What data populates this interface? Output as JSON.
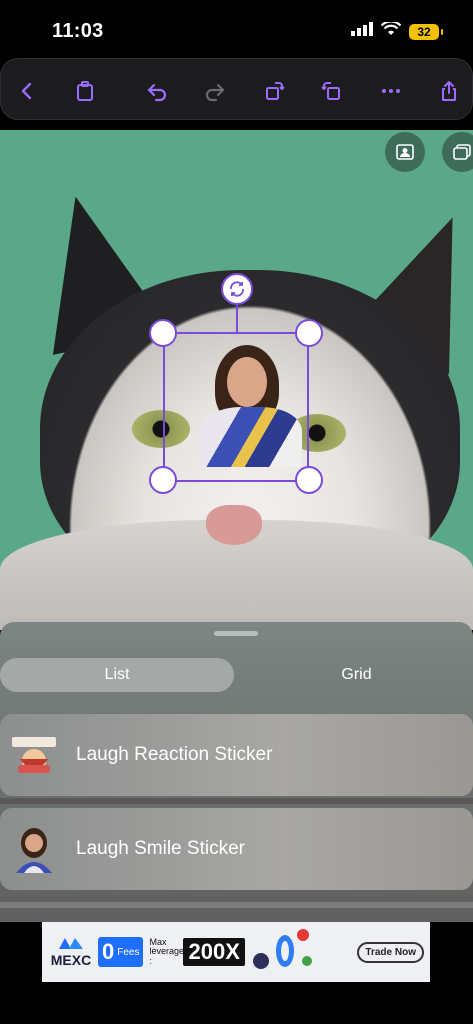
{
  "status_bar": {
    "time": "11:03",
    "battery": "32"
  },
  "toolbar": {
    "buttons": [
      {
        "icon": "chevron-left-icon"
      },
      {
        "icon": "clipboard-icon"
      },
      {
        "icon": "undo-icon"
      },
      {
        "icon": "redo-icon"
      },
      {
        "icon": "rotate-right-icon"
      },
      {
        "icon": "rotate-left-icon"
      },
      {
        "icon": "more-icon"
      },
      {
        "icon": "share-icon"
      }
    ],
    "accent_color": "#9a6cff"
  },
  "canvas": {
    "background_color": "#5aa889",
    "selection_color": "#7c4ad9"
  },
  "sheet": {
    "tabs": [
      {
        "label": "List",
        "selected": true
      },
      {
        "label": "Grid",
        "selected": false
      }
    ],
    "items": [
      {
        "label": "Laugh Reaction Sticker"
      },
      {
        "label": "Laugh Smile Sticker"
      }
    ]
  },
  "ad": {
    "brand": "MEXC",
    "fees_value": "0",
    "fees_label": "Fees",
    "leverage_label": "Max leverage :",
    "leverage_value": "200X",
    "cta": "Trade Now"
  }
}
